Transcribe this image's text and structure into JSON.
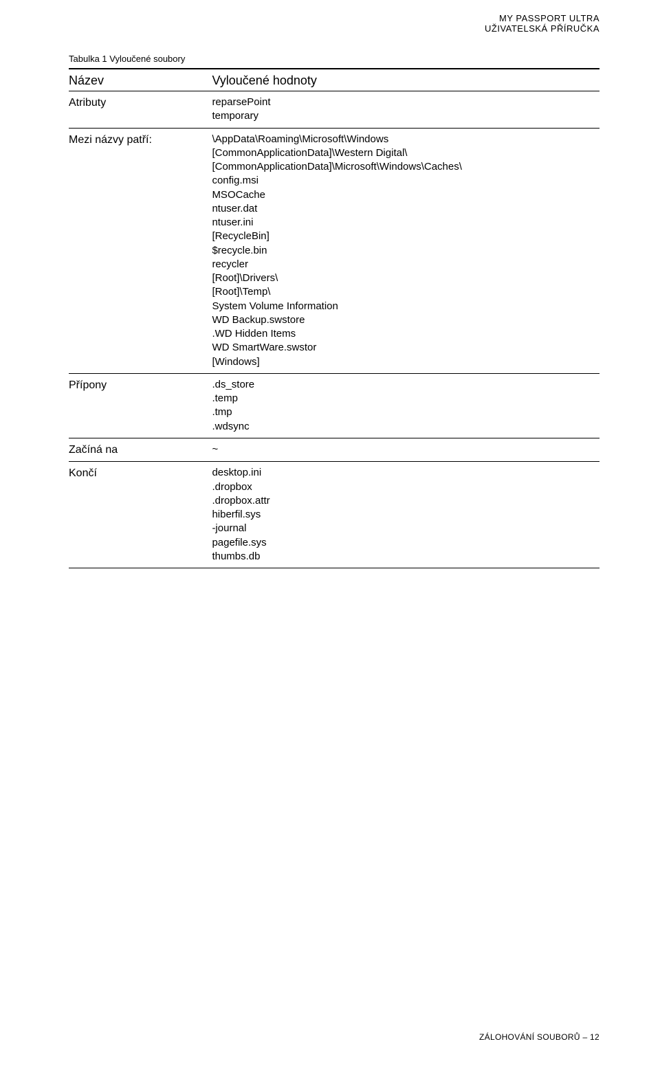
{
  "header": {
    "line1": "MY PASSPORT ULTRA",
    "line2": "UŽIVATELSKÁ PŘÍRUČKA"
  },
  "table": {
    "caption": "Tabulka 1  Vyloučené soubory",
    "head_name": "Název",
    "head_values": "Vyloučené hodnoty",
    "rows": [
      {
        "label": "Atributy",
        "values": [
          "reparsePoint",
          "temporary"
        ]
      },
      {
        "label": "Mezi názvy patří:",
        "values": [
          "\\AppData\\Roaming\\Microsoft\\Windows",
          "[CommonApplicationData]\\Western Digital\\",
          "[CommonApplicationData]\\Microsoft\\Windows\\Caches\\",
          "config.msi",
          "MSOCache",
          "ntuser.dat",
          "ntuser.ini",
          "[RecycleBin]",
          "$recycle.bin",
          "recycler",
          "[Root]\\Drivers\\",
          "[Root]\\Temp\\",
          "System Volume Information",
          "WD Backup.swstore",
          ".WD Hidden Items",
          "WD SmartWare.swstor",
          "[Windows]"
        ]
      },
      {
        "label": "Přípony",
        "values": [
          ".ds_store",
          ".temp",
          ".tmp",
          ".wdsync"
        ]
      },
      {
        "label": "Začíná na",
        "values": [
          "~"
        ]
      },
      {
        "label": "Končí",
        "values": [
          "desktop.ini",
          ".dropbox",
          ".dropbox.attr",
          "hiberfil.sys",
          "-journal",
          "pagefile.sys",
          "thumbs.db"
        ]
      }
    ]
  },
  "footer": "ZÁLOHOVÁNÍ SOUBORŮ – 12"
}
